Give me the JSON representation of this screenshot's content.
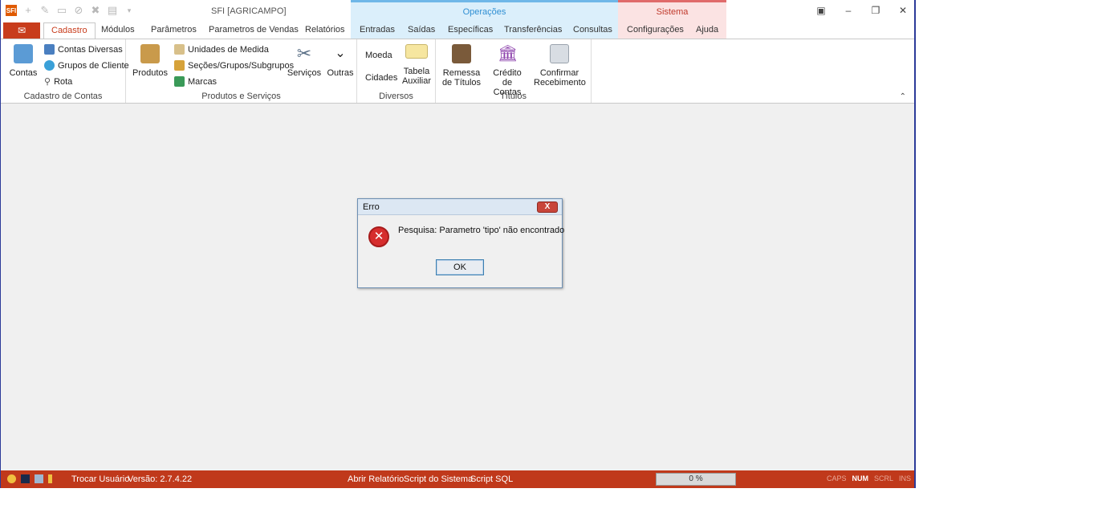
{
  "title_bar": {
    "app_title": "SFI [AGRICAMPO]",
    "logo_text": "SFI",
    "context_operacoes": "Operações",
    "context_sistema": "Sistema",
    "qat_icons": [
      "add-icon",
      "edit-icon",
      "save-icon",
      "cancel-icon",
      "delete-icon",
      "print-icon",
      "customize-icon"
    ]
  },
  "tabs": [
    "Cadastro",
    "Módulos",
    "Parâmetros",
    "Parametros de Vendas",
    "Relatórios",
    "Entradas",
    "Saídas",
    "Específicas",
    "Transferências",
    "Consultas",
    "Configurações",
    "Ajuda"
  ],
  "ribbon": {
    "cadastro_contas": {
      "label": "Cadastro de Contas",
      "contas": "Contas",
      "contas_diversas": "Contas Diversas",
      "grupos_cliente": "Grupos de Cliente",
      "rota": "Rota"
    },
    "produtos_servicos": {
      "label": "Produtos e Serviços",
      "produtos": "Produtos",
      "unidades": "Unidades de Medida",
      "secoes": "Seções/Grupos/Subgrupos",
      "marcas": "Marcas",
      "servicos": "Serviços",
      "outras": "Outras"
    },
    "diversos": {
      "label": "Diversos",
      "moeda": "Moeda",
      "cidades": "Cidades",
      "tabela_line1": "Tabela",
      "tabela_line2": "Auxiliar"
    },
    "titulos": {
      "label": "Títulos",
      "remessa_line1": "Remessa",
      "remessa_line2": "de Títulos",
      "credito_line1": "Crédito",
      "credito_line2": "de Contas",
      "confirmar_line1": "Confirmar",
      "confirmar_line2": "Recebimento"
    }
  },
  "dialog": {
    "title": "Erro",
    "message": "Pesquisa: Parametro 'tipo' não encontrado",
    "ok_label": "OK",
    "close_label": "X"
  },
  "statusbar": {
    "trocar_usuario": "Trocar Usuário",
    "versao": "Versão: 2.7.4.22",
    "abrir_relatorio": "Abrir Relatório",
    "script_sistema": "Script do Sistema",
    "script_sql": "Script SQL",
    "progress": "0 %",
    "progress_value": 0,
    "keys": {
      "caps": "CAPS",
      "num": "NUM",
      "scrl": "SCRL",
      "ins": "INS"
    }
  },
  "colors": {
    "accent": "#c0391b",
    "operacoes": "#2f8fd3",
    "sistema": "#c0392b",
    "error": "#d62d2d"
  }
}
